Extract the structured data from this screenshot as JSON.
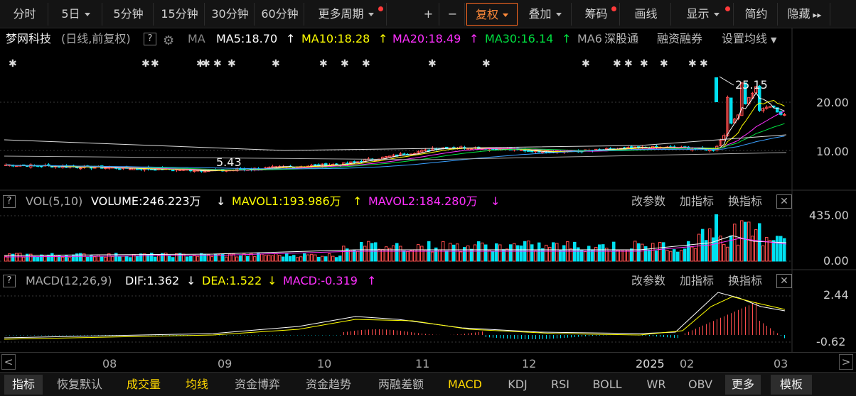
{
  "toolbar": {
    "items": [
      {
        "label": "分时",
        "caret": false,
        "dot": false
      },
      {
        "label": "5日",
        "caret": true,
        "dot": false
      },
      {
        "label": "5分钟",
        "caret": false,
        "dot": false
      },
      {
        "label": "15分钟",
        "caret": false,
        "dot": false
      },
      {
        "label": "30分钟",
        "caret": false,
        "dot": false
      },
      {
        "label": "60分钟",
        "caret": false,
        "dot": false
      },
      {
        "label": "更多周期",
        "caret": true,
        "dot": true
      },
      {
        "label": "+",
        "caret": false,
        "dot": false
      },
      {
        "label": "−",
        "caret": false,
        "dot": false
      },
      {
        "label": "复权",
        "caret": true,
        "dot": false,
        "active": true
      },
      {
        "label": "叠加",
        "caret": true,
        "dot": false
      },
      {
        "label": "筹码",
        "caret": false,
        "dot": true
      },
      {
        "label": "画线",
        "caret": false,
        "dot": false
      },
      {
        "label": "显示",
        "caret": true,
        "dot": true
      },
      {
        "label": "简约",
        "caret": false,
        "dot": false
      },
      {
        "label": "隐藏",
        "caret": false,
        "dot": false
      }
    ]
  },
  "price_panel": {
    "stock_name": "梦网科技",
    "mode": "(日线,前复权)",
    "help": "?",
    "ma_label": "MA",
    "ma5": "MA5:18.70",
    "ma10": "MA10:18.28",
    "ma20": "MA20:18.49",
    "ma30": "MA30:16.14",
    "ma60": "MA6",
    "up_arrow": "↑",
    "sgt": "深股通",
    "margin": "融资融券",
    "set_ma": "设置均线",
    "high_label": "25.15",
    "low_label": "5.43",
    "axis": [
      "20.00",
      "10.00"
    ]
  },
  "vol_panel": {
    "help": "?",
    "name": "VOL(5,10)",
    "volume": "VOLUME:246.223万",
    "mavol1": "MAVOL1:193.986万",
    "mavol2": "MAVOL2:184.280万",
    "down_arrow": "↓",
    "up_arrow": "↑",
    "axis": [
      "435.00",
      "0.00"
    ]
  },
  "macd_panel": {
    "help": "?",
    "name": "MACD(12,26,9)",
    "dif": "DIF:1.362",
    "dea": "DEA:1.522",
    "macd": "MACD:-0.319",
    "down_arrow": "↓",
    "up_arrow": "↑",
    "axis": [
      "2.44",
      "-0.62"
    ]
  },
  "panel_actions": {
    "params": "改参数",
    "add": "加指标",
    "swap": "换指标",
    "close": "✕"
  },
  "xaxis": {
    "labels": [
      {
        "text": "08"
      },
      {
        "text": "09"
      },
      {
        "text": "10"
      },
      {
        "text": "11"
      },
      {
        "text": "12"
      },
      {
        "text": "2025"
      },
      {
        "text": "02"
      },
      {
        "text": "03"
      }
    ],
    "left_arrow": "<",
    "right_arrow": ">"
  },
  "tabs": {
    "items": [
      "指标",
      "恢复默认",
      "成交量",
      "均线",
      "资金博弈",
      "资金趋势",
      "两融差额",
      "MACD",
      "KDJ",
      "RSI",
      "BOLL",
      "WR",
      "OBV",
      "更多",
      "模板"
    ]
  },
  "colors": {
    "up": "#ff4d4d",
    "down": "#00e0f0",
    "ma5": "#ffffff",
    "ma10": "#ffff00",
    "ma20": "#ff30ff",
    "ma30": "#00e040",
    "ma60": "#3aa0ff",
    "tab_yellow": "#ffd700"
  },
  "chart_data": {
    "type": "candlestick",
    "price_axis": [
      10.0,
      20.0
    ],
    "high": 25.15,
    "low": 5.43,
    "ma": {
      "MA5": 18.7,
      "MA10": 18.28,
      "MA20": 18.49,
      "MA30": 16.14
    },
    "volume": {
      "VOLUME": 246.223,
      "MAVOL1": 193.986,
      "MAVOL2": 184.28,
      "axis_max": 435.0,
      "axis_min": 0.0
    },
    "macd": {
      "DIF": 1.362,
      "DEA": 1.522,
      "MACD": -0.319,
      "axis_max": 2.44,
      "axis_min": -0.62
    },
    "x_labels": [
      "08",
      "09",
      "10",
      "11",
      "12",
      "2025",
      "02",
      "03"
    ]
  }
}
